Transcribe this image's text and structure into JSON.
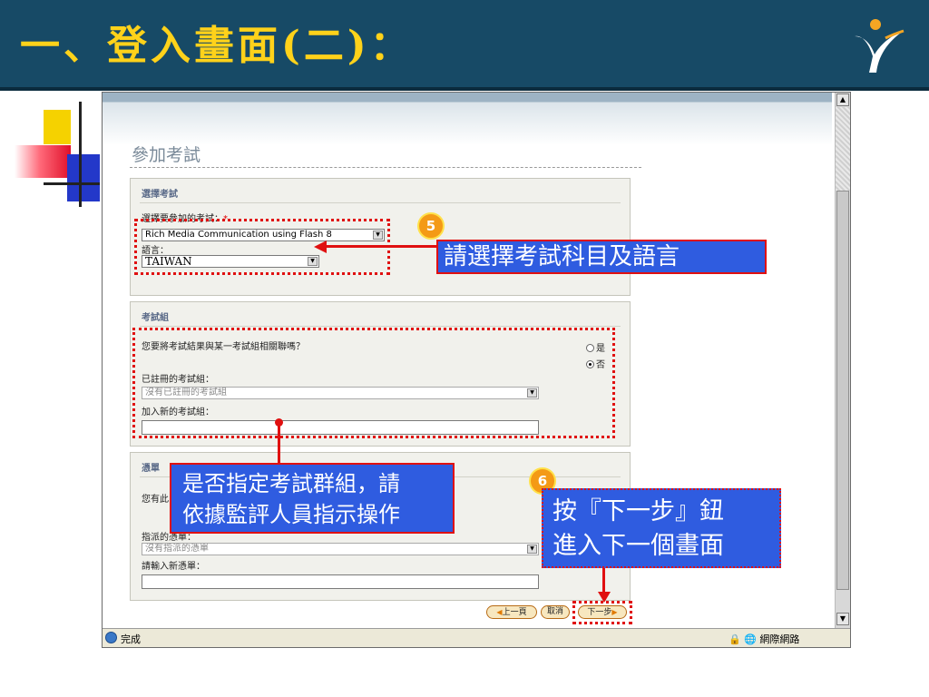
{
  "slide": {
    "title": "一、登入畫面(二)："
  },
  "browser": {
    "status_text": "完成",
    "status_zone": "網際網路"
  },
  "page": {
    "title": "參加考試",
    "section_exam": {
      "heading": "選擇考試",
      "exam_label": "選擇要參加的考試：",
      "required_mark": "*",
      "exam_value": "Rich Media Communication using Flash 8",
      "language_label": "語言：",
      "language_value": "TAIWAN"
    },
    "section_group": {
      "heading": "考試組",
      "question": "您要將考試結果與某一考試組相關聯嗎？",
      "option_yes": "是",
      "option_no": "否",
      "registered_label": "已註冊的考試組：",
      "registered_value": "沒有已註冊的考試組",
      "new_label": "加入新的考試組：",
      "new_value": ""
    },
    "section_voucher": {
      "heading": "憑單",
      "question": "您有此",
      "assigned_label": "指派的憑單：",
      "assigned_value": "沒有指派的憑單",
      "new_label": "請輸入新憑單：",
      "new_value": ""
    },
    "buttons": {
      "prev": "上一頁",
      "cancel": "取消",
      "next": "下一步"
    }
  },
  "annotations": {
    "badge5": "5",
    "callout5": "請選擇考試科目及語言",
    "callout_group": [
      "是否指定考試群組，請",
      "依據監評人員指示操作"
    ],
    "badge6": "6",
    "callout6": [
      "按『下一步』鈕",
      "進入下一個畫面"
    ]
  },
  "colors": {
    "header_bg": "#174a66",
    "title_color": "#ffd21a",
    "callout_bg": "#2f5ce0",
    "annotation_red": "#e01010",
    "badge_orange": "#f49a16"
  }
}
